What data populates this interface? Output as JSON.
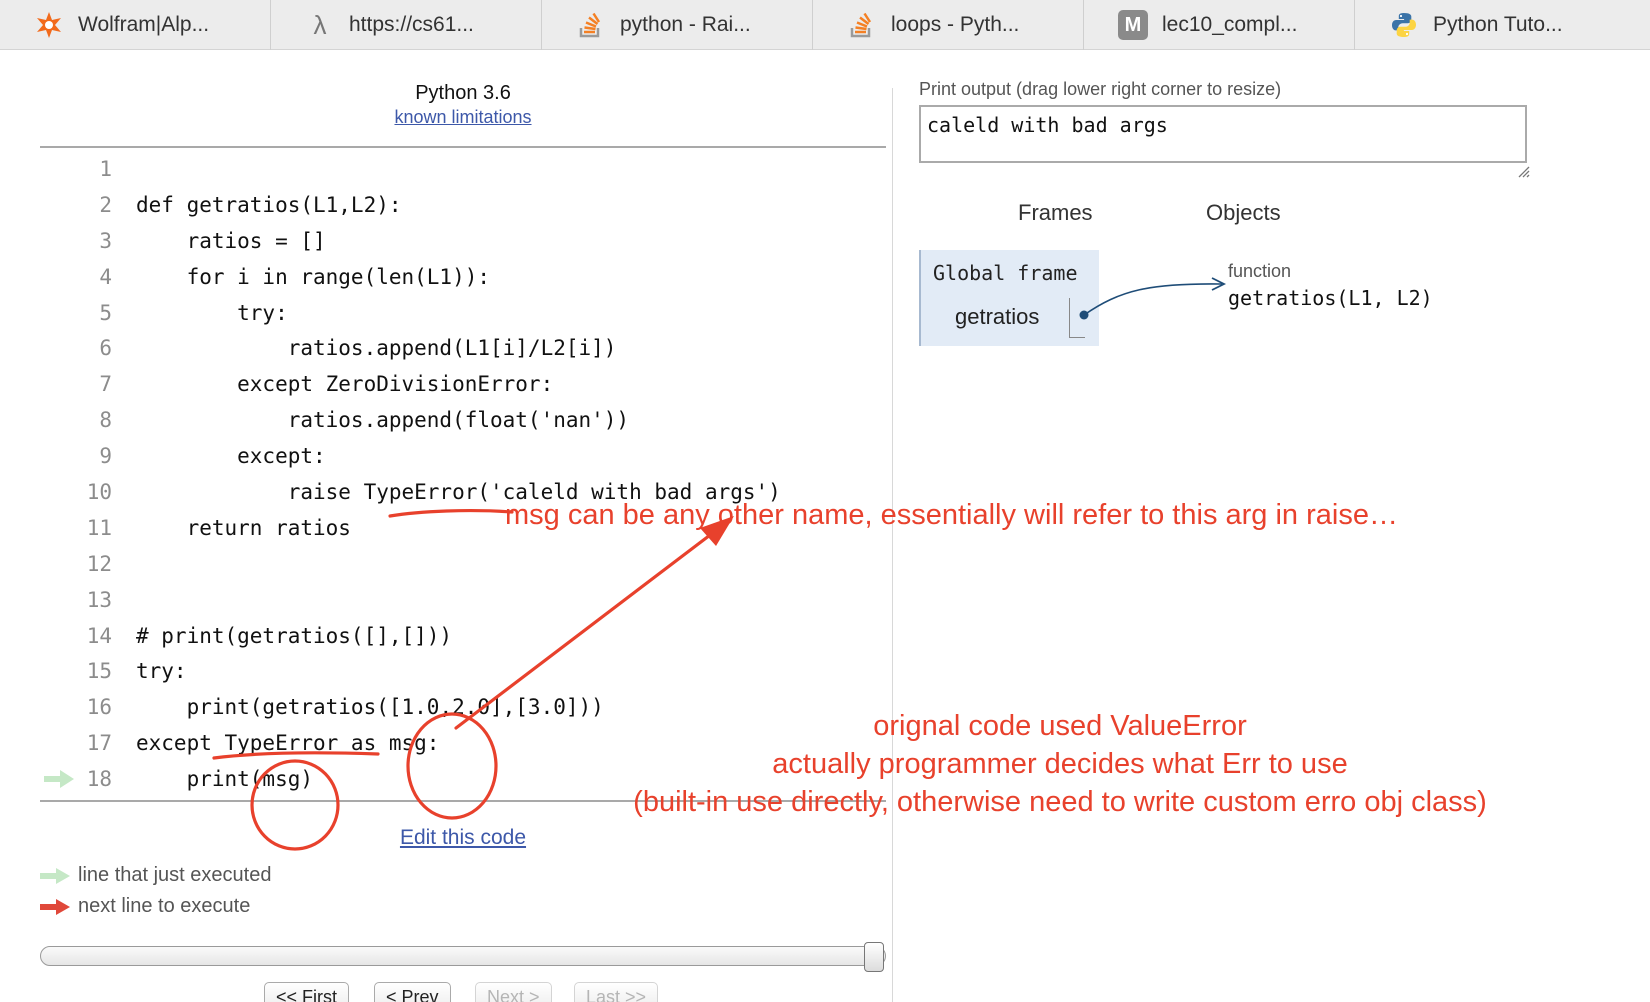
{
  "tabs": [
    {
      "title": "Wolfram|Alp...",
      "icon": "wolfram-icon"
    },
    {
      "title": "https://cs61...",
      "icon": "lambda-icon"
    },
    {
      "title": "python - Rai...",
      "icon": "stackoverflow-icon"
    },
    {
      "title": "loops - Pyth...",
      "icon": "stackoverflow-icon"
    },
    {
      "title": "lec10_compl...",
      "icon": "m-letter-icon"
    },
    {
      "title": "Python Tuto...",
      "icon": "python-logo-icon"
    }
  ],
  "editor": {
    "language": "Python 3.6",
    "limitations_link": "known limitations",
    "edit_link": "Edit this code",
    "lines": [
      {
        "num": "1",
        "text": ""
      },
      {
        "num": "2",
        "text": "def getratios(L1,L2):"
      },
      {
        "num": "3",
        "text": "    ratios = []"
      },
      {
        "num": "4",
        "text": "    for i in range(len(L1)):"
      },
      {
        "num": "5",
        "text": "        try:"
      },
      {
        "num": "6",
        "text": "            ratios.append(L1[i]/L2[i])"
      },
      {
        "num": "7",
        "text": "        except ZeroDivisionError:"
      },
      {
        "num": "8",
        "text": "            ratios.append(float('nan'))"
      },
      {
        "num": "9",
        "text": "        except:"
      },
      {
        "num": "10",
        "text": "            raise TypeError('caleld with bad args')"
      },
      {
        "num": "11",
        "text": "    return ratios"
      },
      {
        "num": "12",
        "text": ""
      },
      {
        "num": "13",
        "text": ""
      },
      {
        "num": "14",
        "text": "# print(getratios([],[]))"
      },
      {
        "num": "15",
        "text": "try:"
      },
      {
        "num": "16",
        "text": "    print(getratios([1.0,2.0],[3.0]))"
      },
      {
        "num": "17",
        "text": "except TypeError as msg:"
      },
      {
        "num": "18",
        "text": "    print(msg)"
      }
    ],
    "current_line": "18"
  },
  "legend": {
    "just_executed": "line that just executed",
    "next_to_execute": "next line to execute",
    "just_executed_color": "#c5e8c6",
    "next_color": "#e0483a"
  },
  "navigation": {
    "first": "<< First",
    "prev": "< Prev",
    "next": "Next >",
    "last": "Last >>"
  },
  "output": {
    "label": "Print output (drag lower right corner to resize)",
    "text": "caleld with bad args"
  },
  "visualizer": {
    "frames_header": "Frames",
    "objects_header": "Objects",
    "global_frame_title": "Global frame",
    "variable": "getratios",
    "object_type": "function",
    "object_signature": "getratios(L1, L2)",
    "pointer_color": "#1f4d78"
  },
  "annotations": {
    "color": "#e8412c",
    "msg_note": "msg can be any other name, essentially will refer to this arg in raise…",
    "error_note_line1": "orignal code used ValueError",
    "error_note_line2": "actually programmer decides what Err to use",
    "error_note_line3": "(built-in use directly, otherwise need to write custom erro obj class)"
  }
}
